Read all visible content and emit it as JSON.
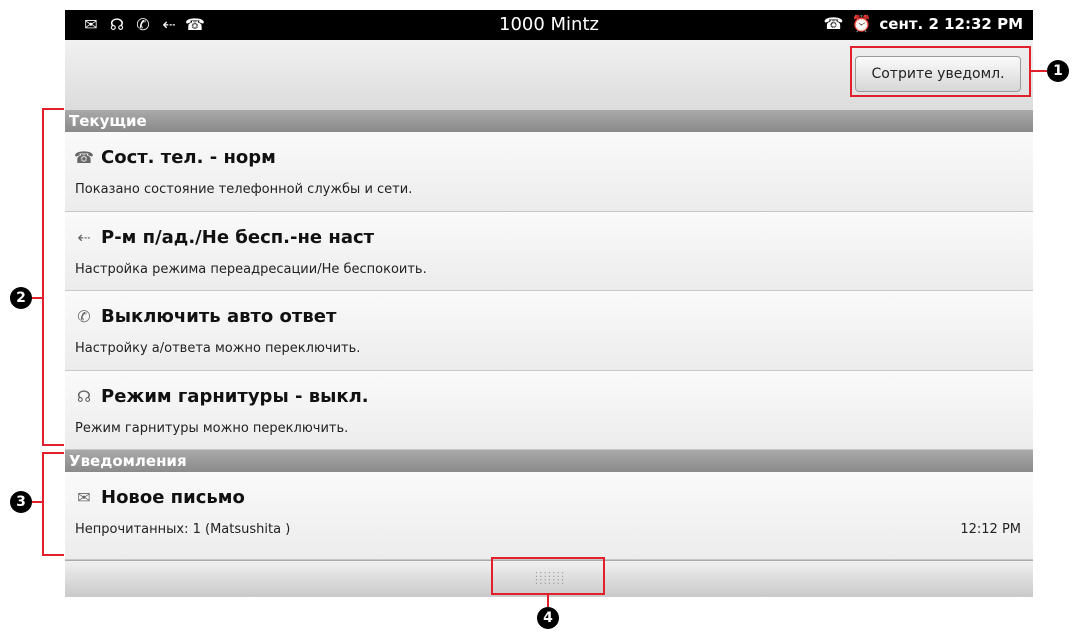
{
  "status_bar": {
    "carrier": "1000 Mintz",
    "date_time": "сент. 2 12:32 PM",
    "left_icons": [
      "mail-icon",
      "headset-icon",
      "auto-answer-icon",
      "forward-icon",
      "phone-icon"
    ],
    "right_icons": [
      "handset-icon",
      "alarm-icon"
    ]
  },
  "toolbar": {
    "clear_label": "Сотрите уведомл."
  },
  "sections": {
    "current": {
      "header": "Текущие",
      "items": [
        {
          "title": "Сост. тел. - норм",
          "subtitle": "Показано состояние телефонной службы и сети.",
          "icon": "phone-status-icon"
        },
        {
          "title": "Р-м п/ад./Не бесп.-не наст",
          "subtitle": "Настройка режима переадресации/Не беспокоить.",
          "icon": "forward-icon"
        },
        {
          "title": "Выключить авто ответ",
          "subtitle": "Настройку а/ответа можно переключить.",
          "icon": "auto-answer-off-icon"
        },
        {
          "title": "Режим гарнитуры - выкл.",
          "subtitle": "Режим гарнитуры можно переключить.",
          "icon": "headset-off-icon"
        }
      ]
    },
    "notifications": {
      "header": "Уведомления",
      "items": [
        {
          "title": "Новое письмо",
          "subtitle": "Непрочитанных: 1 (Matsushita )",
          "time": "12:12 PM",
          "icon": "mail-icon"
        }
      ]
    }
  },
  "callouts": [
    "1",
    "2",
    "3",
    "4"
  ],
  "colors": {
    "annotation_red": "#e0202a",
    "section_header": "#8a8a8a"
  }
}
